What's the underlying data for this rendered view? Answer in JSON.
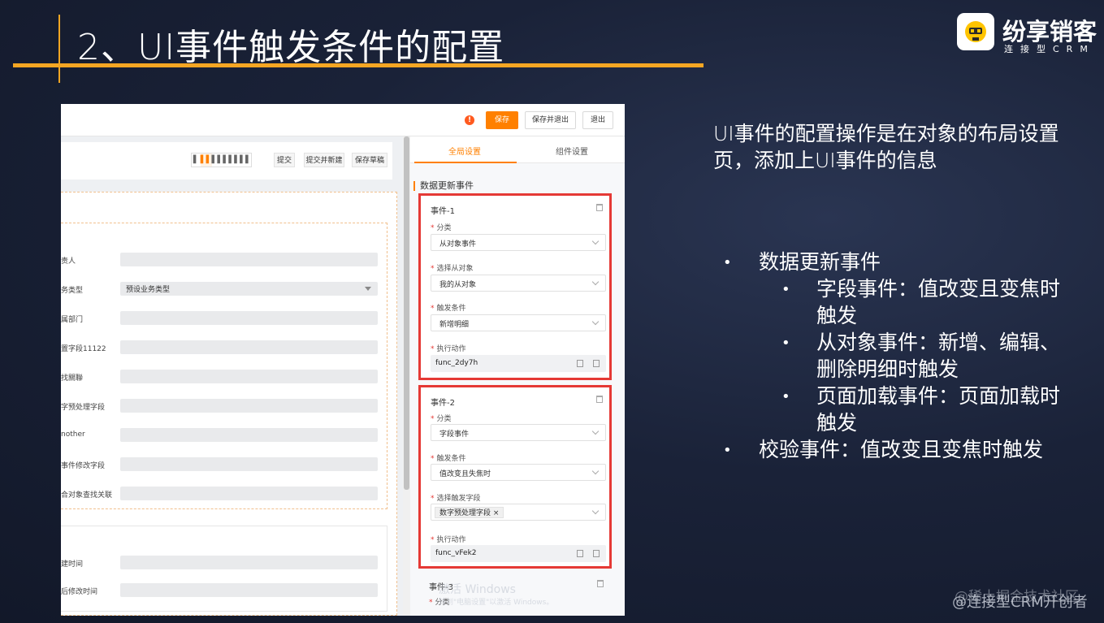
{
  "slide": {
    "title": "2、UI事件触发条件的配置",
    "logo_name": "纷享销客",
    "logo_sub": "连接型CRM",
    "description": "UI事件的配置操作是在对象的布局设置页，添加上UI事件的信息",
    "bullets": {
      "b1": "数据更新事件",
      "b1_1a": "字段事件：值改变且变焦时",
      "b1_1b": "触发",
      "b1_2a": "从对象事件：新增、编辑、",
      "b1_2b": "删除明细时触发",
      "b1_3a": "页面加载事件：页面加载时",
      "b1_3b": "触发",
      "b2": "校验事件：值改变且变焦时触发"
    },
    "credit": "@连接型CRM开创者",
    "credit_overlay": "@稀土掘金技术社区"
  },
  "topbar": {
    "warn_glyph": "!",
    "save": "保存",
    "save_exit": "保存并退出",
    "exit": "退出"
  },
  "canvas": {
    "cols": [
      "▌",
      "▌▌",
      "▌▌▌",
      "▌▌▌▌"
    ],
    "submit": "提交",
    "submit_new": "提交并新建",
    "draft": "保存草稿",
    "fields": [
      {
        "label": "责人",
        "value": ""
      },
      {
        "label": "务类型",
        "value": "预设业务类型"
      },
      {
        "label": "属部门",
        "value": ""
      },
      {
        "label": "置字段11122",
        "value": ""
      },
      {
        "label": "找關聯",
        "value": ""
      },
      {
        "label": "字预处理字段",
        "value": ""
      },
      {
        "label": "nother",
        "value": ""
      },
      {
        "label": "事件修改字段",
        "value": ""
      },
      {
        "label": "合对象查找关联",
        "value": ""
      }
    ],
    "fields2": [
      {
        "label": "建时间",
        "value": ""
      },
      {
        "label": "后修改时间",
        "value": ""
      }
    ]
  },
  "panel": {
    "tab_global": "全局设置",
    "tab_component": "组件设置",
    "section_title": "数据更新事件",
    "event1": {
      "title": "事件-1",
      "l1": "分类",
      "v1": "从对象事件",
      "l2": "选择从对象",
      "v2": "我的从对象",
      "l3": "触发条件",
      "v3": "新增明细",
      "l4": "执行动作",
      "v4": "func_2dy7h"
    },
    "event2": {
      "title": "事件-2",
      "l1": "分类",
      "v1": "字段事件",
      "l2": "触发条件",
      "v2": "值改变且失焦时",
      "l3": "选择触发字段",
      "tag": "数字预处理字段",
      "l4": "执行动作",
      "v4": "func_vFek2"
    },
    "event3": {
      "title": "事件-3",
      "l1": "分类"
    }
  },
  "overlay": {
    "activate": "激活 Windows",
    "activate_hint": "转到\"电脑设置\"以激活 Windows。"
  },
  "colors": {
    "accent": "#f5a623",
    "button_orange": "#ff8000",
    "highlight_red": "#e53935"
  }
}
